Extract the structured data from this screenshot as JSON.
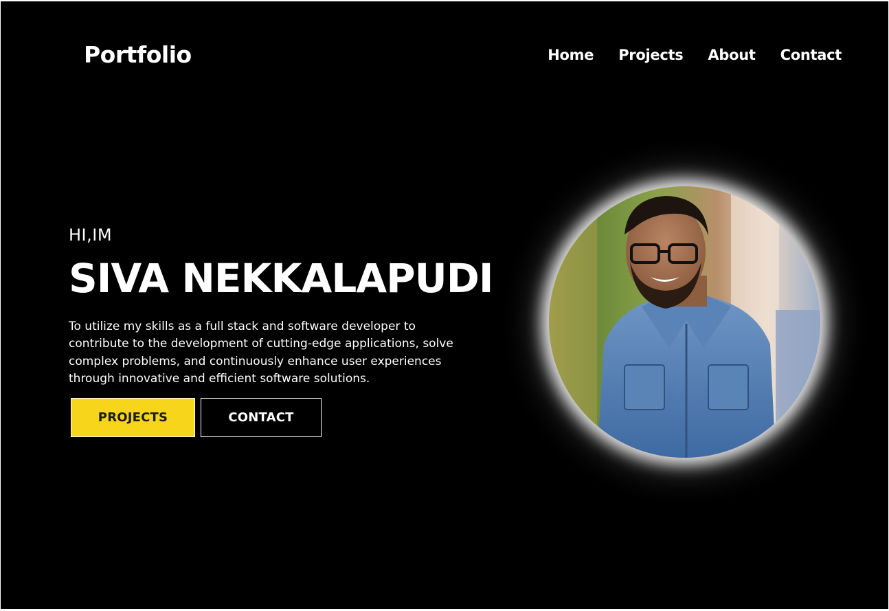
{
  "header": {
    "logo": "Portfolio",
    "nav": [
      "Home",
      "Projects",
      "About",
      "Contact"
    ]
  },
  "hero": {
    "greeting": "HI,IM",
    "name": "SIVA NEKKALAPUDI",
    "summary": "To utilize my skills as a full stack and software developer to contribute to the development of cutting-edge applications, solve complex problems, and continuously enhance user experiences through innovative and efficient software solutions.",
    "buttons": {
      "projects": "PROJECTS",
      "contact": "CONTACT"
    }
  },
  "colors": {
    "background": "#000000",
    "accent": "#f7d51a",
    "text": "#ffffff"
  }
}
